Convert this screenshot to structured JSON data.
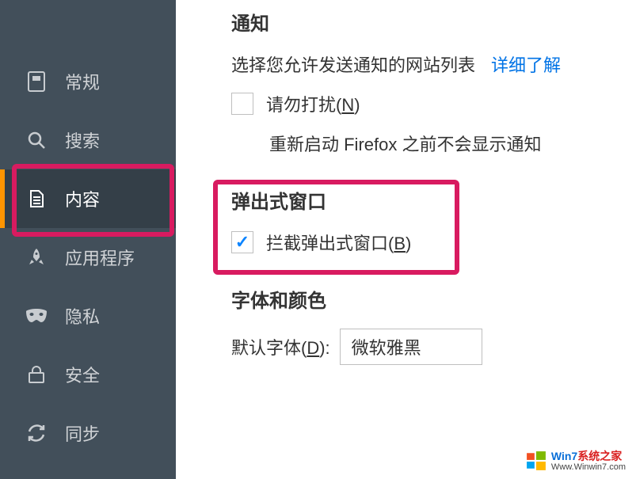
{
  "sidebar": {
    "items": [
      {
        "label": "常规"
      },
      {
        "label": "搜索"
      },
      {
        "label": "内容"
      },
      {
        "label": "应用程序"
      },
      {
        "label": "隐私"
      },
      {
        "label": "安全"
      },
      {
        "label": "同步"
      }
    ]
  },
  "sections": {
    "notifications": {
      "title": "通知",
      "row1_text": "选择您允许发送通知的网站列表",
      "learn_more": "详细了解",
      "dnd_prefix": "请勿打扰(",
      "dnd_hotkey": "N",
      "dnd_suffix": ")",
      "sub_text": "重新启动 Firefox 之前不会显示通知"
    },
    "popups": {
      "title": "弹出式窗口",
      "block_prefix": "拦截弹出式窗口(",
      "block_hotkey": "B",
      "block_suffix": ")"
    },
    "fonts": {
      "title": "字体和颜色",
      "label_prefix": "默认字体(",
      "label_hotkey": "D",
      "label_suffix": "):",
      "default_font": "微软雅黑"
    }
  },
  "watermark": {
    "line1_a": "Win7",
    "line1_b": "系统之家",
    "line2": "Www.Winwin7.com"
  }
}
